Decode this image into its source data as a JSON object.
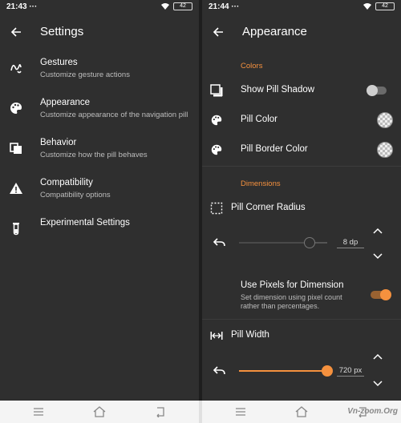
{
  "left_screen": {
    "status": {
      "time": "21:43 ···",
      "battery": "42"
    },
    "title": "Settings",
    "items": [
      {
        "title": "Gestures",
        "subtitle": "Customize gesture actions",
        "icon": "gesture-icon"
      },
      {
        "title": "Appearance",
        "subtitle": "Customize appearance of the navigation pill",
        "icon": "palette-icon"
      },
      {
        "title": "Behavior",
        "subtitle": "Customize how the pill behaves",
        "icon": "copy-icon"
      },
      {
        "title": "Compatibility",
        "subtitle": "Compatibility options",
        "icon": "warning-icon"
      },
      {
        "title": "Experimental Settings",
        "subtitle": "",
        "icon": "flask-icon"
      }
    ]
  },
  "right_screen": {
    "status": {
      "time": "21:44 ···",
      "battery": "42"
    },
    "title": "Appearance",
    "colors_section": "Colors",
    "show_pill_shadow": {
      "label": "Show Pill Shadow",
      "enabled": false
    },
    "pill_color": {
      "label": "Pill Color"
    },
    "pill_border_color": {
      "label": "Pill Border Color"
    },
    "dimensions_section": "Dimensions",
    "pill_corner_radius": {
      "label": "Pill Corner Radius",
      "value": "8 dp",
      "fraction": 0.8
    },
    "use_pixels": {
      "title": "Use Pixels for Dimension",
      "subtitle_line1": "Set dimension using pixel count",
      "subtitle_line2": "rather than percentages.",
      "enabled": true
    },
    "pill_width": {
      "label": "Pill Width",
      "value": "720 px",
      "fraction": 1.0
    }
  },
  "watermark": "Vn-zoom.Org",
  "colors": {
    "accent": "#f5913e",
    "background": "#2f2f2f",
    "nav_bar": "#f4f4f4"
  }
}
